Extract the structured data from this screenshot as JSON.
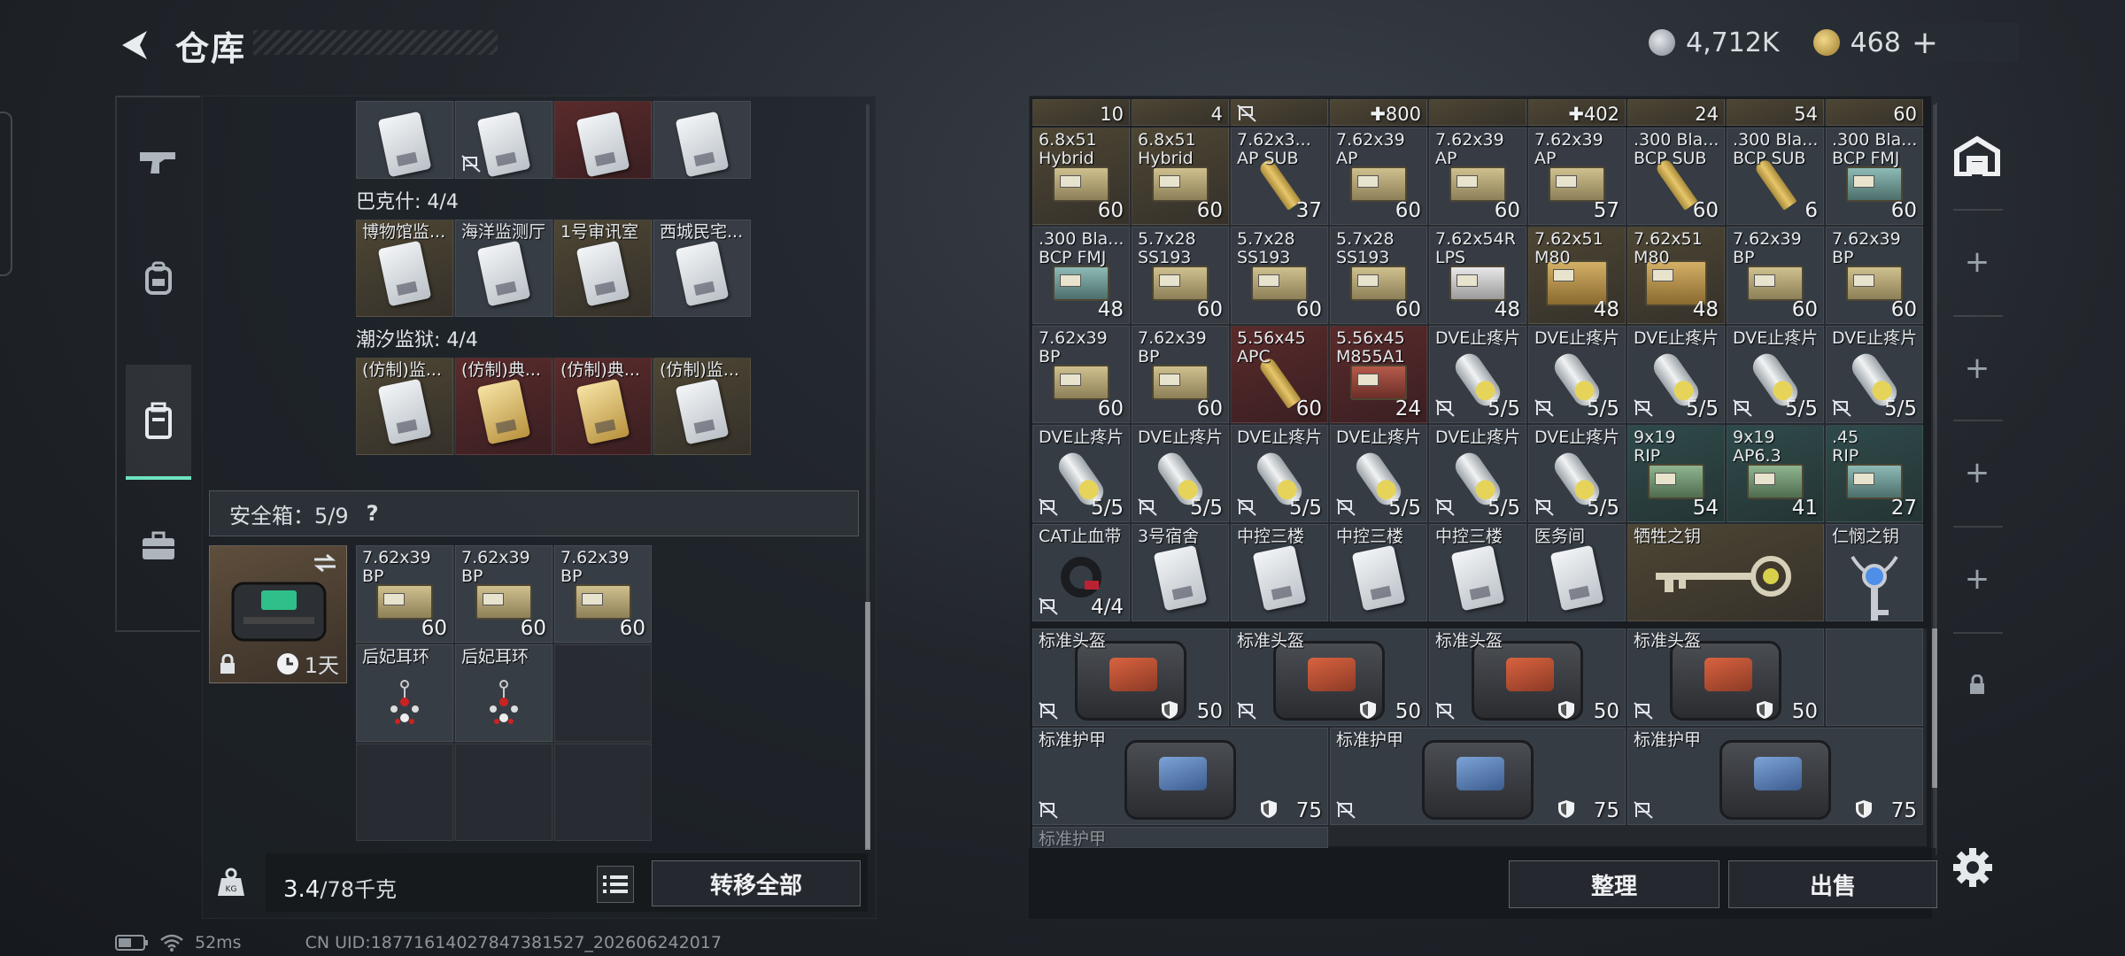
{
  "header": {
    "title": "仓库",
    "currency_silver": "4,712K",
    "currency_gold": "468",
    "plus": "+"
  },
  "colors": {
    "accent": "#6fe3c0",
    "panel": "#1e2228"
  },
  "side_nav": [
    {
      "name": "weapon",
      "icon": "gun-icon"
    },
    {
      "name": "gear",
      "icon": "backpack-icon"
    },
    {
      "name": "container",
      "icon": "case-icon",
      "active": true
    },
    {
      "name": "briefcase",
      "icon": "briefcase-icon"
    }
  ],
  "left": {
    "sections": {
      "bakshi": "巴克什: 4/4",
      "chaoxi": "潮汐监狱: 4/4"
    },
    "top_row": [
      "",
      "",
      "",
      ""
    ],
    "bakshi_items": [
      "博物馆监...",
      "海洋监测厅",
      "1号审讯室",
      "西城民宅..."
    ],
    "chaoxi_items": [
      "(仿制)监...",
      "(仿制)典...",
      "(仿制)典...",
      "(仿制)监..."
    ],
    "safe_label": "安全箱：5/9",
    "safe_help": "?",
    "safe_timer": "1天",
    "safe_items": [
      {
        "n1": "7.62x39",
        "n2": "BP",
        "q": "60"
      },
      {
        "n1": "7.62x39",
        "n2": "BP",
        "q": "60"
      },
      {
        "n1": "7.62x39",
        "n2": "BP",
        "q": "60"
      },
      {
        "n1": "后妃耳环",
        "n2": "",
        "q": ""
      },
      {
        "n1": "后妃耳环",
        "n2": "",
        "q": ""
      }
    ],
    "weight_current": "3.4",
    "weight_max": "/78千克",
    "transfer_all": "转移全部"
  },
  "status": {
    "ping": "52ms",
    "uid": "CN UID:18771614027847381527_202606242017"
  },
  "right": {
    "top_partial": [
      "10",
      "4",
      "",
      "✚800",
      "",
      "✚402",
      "24",
      "54",
      "60"
    ],
    "row1": [
      {
        "n1": "6.8x51",
        "n2": "Hybrid",
        "q": "60",
        "t": "tan",
        "a": "ammo"
      },
      {
        "n1": "6.8x51",
        "n2": "Hybrid",
        "q": "60",
        "t": "tan",
        "a": "ammo"
      },
      {
        "n1": "7.62x3...",
        "n2": "AP SUB",
        "q": "37",
        "t": "",
        "a": "bullet"
      },
      {
        "n1": "7.62x39",
        "n2": "AP",
        "q": "60",
        "t": "",
        "a": "ammo"
      },
      {
        "n1": "7.62x39",
        "n2": "AP",
        "q": "60",
        "t": "",
        "a": "ammo"
      },
      {
        "n1": "7.62x39",
        "n2": "AP",
        "q": "57",
        "t": "",
        "a": "ammo"
      },
      {
        "n1": ".300 Bla...",
        "n2": "BCP SUB",
        "q": "60",
        "t": "",
        "a": "bullet"
      },
      {
        "n1": ".300 Bla...",
        "n2": "BCP SUB",
        "q": "6",
        "t": "",
        "a": "bullet"
      },
      {
        "n1": ".300 Bla...",
        "n2": "BCP FMJ",
        "q": "60",
        "t": "",
        "a": "ammo teal"
      }
    ],
    "row2": [
      {
        "n1": ".300 Bla...",
        "n2": "BCP FMJ",
        "q": "48",
        "t": "",
        "a": "ammo teal"
      },
      {
        "n1": "5.7x28",
        "n2": "SS193",
        "q": "60",
        "t": "",
        "a": "ammo"
      },
      {
        "n1": "5.7x28",
        "n2": "SS193",
        "q": "60",
        "t": "",
        "a": "ammo"
      },
      {
        "n1": "5.7x28",
        "n2": "SS193",
        "q": "60",
        "t": "",
        "a": "ammo"
      },
      {
        "n1": "7.62x54R",
        "n2": "LPS",
        "q": "48",
        "t": "",
        "a": "ammo white"
      },
      {
        "n1": "7.62x51",
        "n2": "M80",
        "q": "48",
        "t": "tan",
        "a": "ammo box"
      },
      {
        "n1": "7.62x51",
        "n2": "M80",
        "q": "48",
        "t": "tan",
        "a": "ammo box"
      },
      {
        "n1": "7.62x39",
        "n2": "BP",
        "q": "60",
        "t": "",
        "a": "ammo"
      },
      {
        "n1": "7.62x39",
        "n2": "BP",
        "q": "60",
        "t": "",
        "a": "ammo"
      }
    ],
    "row3": [
      {
        "n1": "7.62x39",
        "n2": "BP",
        "q": "60",
        "t": "",
        "a": "ammo"
      },
      {
        "n1": "7.62x39",
        "n2": "BP",
        "q": "60",
        "t": "",
        "a": "ammo"
      },
      {
        "n1": "5.56x45",
        "n2": "APC",
        "q": "60",
        "t": "red",
        "a": "bullet"
      },
      {
        "n1": "5.56x45",
        "n2": "M855A1",
        "q": "24",
        "t": "red",
        "a": "ammo red"
      },
      {
        "n1": "DVE止疼片",
        "n2": "",
        "q": "5/5",
        "t": "",
        "a": "pill",
        "f": true
      },
      {
        "n1": "DVE止疼片",
        "n2": "",
        "q": "5/5",
        "t": "",
        "a": "pill",
        "f": true
      },
      {
        "n1": "DVE止疼片",
        "n2": "",
        "q": "5/5",
        "t": "",
        "a": "pill",
        "f": true
      },
      {
        "n1": "DVE止疼片",
        "n2": "",
        "q": "5/5",
        "t": "",
        "a": "pill",
        "f": true
      },
      {
        "n1": "DVE止疼片",
        "n2": "",
        "q": "5/5",
        "t": "",
        "a": "pill",
        "f": true
      }
    ],
    "row4": [
      {
        "n1": "DVE止疼片",
        "n2": "",
        "q": "5/5",
        "t": "",
        "a": "pill",
        "f": true
      },
      {
        "n1": "DVE止疼片",
        "n2": "",
        "q": "5/5",
        "t": "",
        "a": "pill",
        "f": true
      },
      {
        "n1": "DVE止疼片",
        "n2": "",
        "q": "5/5",
        "t": "",
        "a": "pill",
        "f": true
      },
      {
        "n1": "DVE止疼片",
        "n2": "",
        "q": "5/5",
        "t": "",
        "a": "pill",
        "f": true
      },
      {
        "n1": "DVE止疼片",
        "n2": "",
        "q": "5/5",
        "t": "",
        "a": "pill",
        "f": true
      },
      {
        "n1": "DVE止疼片",
        "n2": "",
        "q": "5/5",
        "t": "",
        "a": "pill",
        "f": true
      },
      {
        "n1": "9x19",
        "n2": "RIP",
        "q": "54",
        "t": "teal",
        "a": "ammo green"
      },
      {
        "n1": "9x19",
        "n2": "AP6.3",
        "q": "41",
        "t": "teal",
        "a": "ammo green"
      },
      {
        "n1": ".45",
        "n2": "RIP",
        "q": "27",
        "t": "teal",
        "a": "ammo teal"
      }
    ],
    "row5": [
      {
        "n1": "CAT止血带",
        "n2": "",
        "q": "4/4",
        "t": "",
        "a": "tourniquet",
        "f": true
      },
      {
        "n1": "3号宿舍",
        "n2": "",
        "q": "",
        "t": "",
        "a": "card"
      },
      {
        "n1": "中控三楼",
        "n2": "",
        "q": "",
        "t": "",
        "a": "card"
      },
      {
        "n1": "中控三楼",
        "n2": "",
        "q": "",
        "t": "",
        "a": "card"
      },
      {
        "n1": "中控三楼",
        "n2": "",
        "q": "",
        "t": "",
        "a": "card"
      },
      {
        "n1": "医务间",
        "n2": "",
        "q": "",
        "t": "",
        "a": "card"
      }
    ],
    "key1": "牺牲之钥",
    "key2": "仁悯之钥",
    "helmets": [
      {
        "n": "标准头盔",
        "q": "50"
      },
      {
        "n": "标准头盔",
        "q": "50"
      },
      {
        "n": "标准头盔",
        "q": "50"
      },
      {
        "n": "标准头盔",
        "q": "50"
      }
    ],
    "armors": [
      {
        "n": "标准护甲",
        "q": "75"
      },
      {
        "n": "标准护甲",
        "q": "75"
      },
      {
        "n": "标准护甲",
        "q": "75"
      }
    ],
    "partial_bottom": "标准护甲",
    "sort_btn": "整理",
    "sell_btn": "出售"
  },
  "right_tabs": [
    "home-icon",
    "+",
    "+",
    "+",
    "+",
    "lock-icon"
  ]
}
